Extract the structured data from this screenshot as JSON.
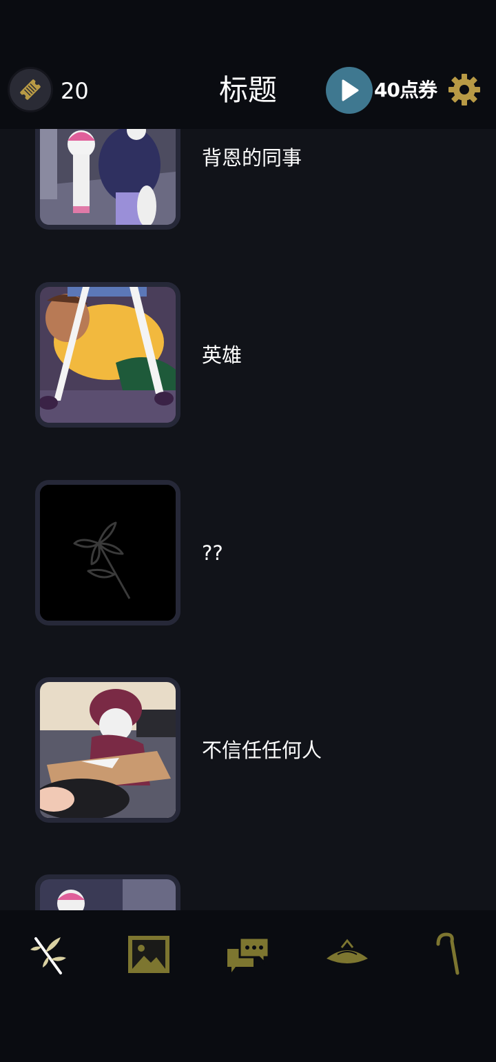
{
  "header": {
    "ticket_count": "20",
    "title": "标题",
    "points_label": "40点券"
  },
  "icons": {
    "ticket": "ticket-icon",
    "play": "play-icon",
    "settings": "gear-icon"
  },
  "stories": [
    {
      "title": "背恩的同事",
      "thumbnail": "two-characters-scene"
    },
    {
      "title": "英雄",
      "thumbnail": "yellow-shirt-crawling-scene"
    },
    {
      "title": "??",
      "thumbnail": "locked-flower-silhouette"
    },
    {
      "title": "不信任任何人",
      "thumbnail": "classroom-desk-scene"
    },
    {
      "title": "",
      "thumbnail": "partially-visible-scene"
    }
  ],
  "tabs": [
    {
      "name": "branch-tab",
      "icon": "branch-icon",
      "active": true
    },
    {
      "name": "gallery-tab",
      "icon": "picture-icon",
      "active": false
    },
    {
      "name": "chat-tab",
      "icon": "chat-bubbles-icon",
      "active": false
    },
    {
      "name": "hat-tab",
      "icon": "hat-icon",
      "active": false
    },
    {
      "name": "cane-tab",
      "icon": "cane-icon",
      "active": false
    }
  ],
  "colors": {
    "background": "#111319",
    "header": "#0a0c11",
    "accent_gold": "#7d7630",
    "play_blue": "#3f7890",
    "gear_gold": "#b89a45"
  }
}
